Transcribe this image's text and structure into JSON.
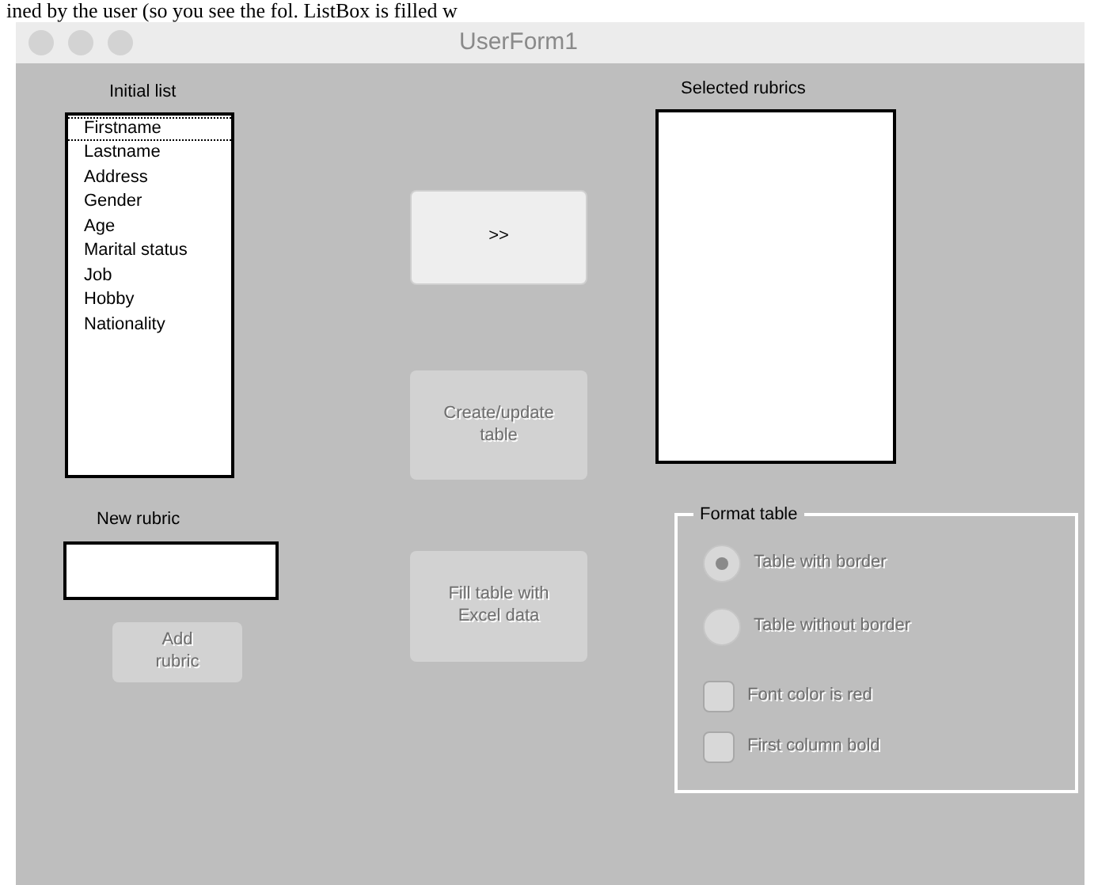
{
  "caption": "ined by the user (so you see the fol. ListBox is filled w",
  "window": {
    "title": "UserForm1"
  },
  "initial_list": {
    "label": "Initial list",
    "items": [
      {
        "text": "Firstname",
        "focused": true
      },
      {
        "text": "Lastname",
        "focused": false
      },
      {
        "text": "Address",
        "focused": false
      },
      {
        "text": "Gender",
        "focused": false
      },
      {
        "text": "Age",
        "focused": false
      },
      {
        "text": "Marital status",
        "focused": false
      },
      {
        "text": "Job",
        "focused": false
      },
      {
        "text": "Hobby",
        "focused": false
      },
      {
        "text": "Nationality",
        "focused": false
      }
    ]
  },
  "new_rubric": {
    "label": "New rubric"
  },
  "add_button": {
    "label": "Add rubric",
    "disabled": true
  },
  "buttons": [
    {
      "label": ">>",
      "disabled": false
    },
    {
      "label": "Create/update table",
      "disabled": true
    },
    {
      "label": "Fill table with Excel data",
      "disabled": true
    }
  ],
  "selected_rubrics": {
    "label": "Selected rubrics"
  },
  "format_table": {
    "title": "Format table",
    "options": [
      {
        "kind": "radio",
        "label": "Table with border",
        "checked": true,
        "disabled": true
      },
      {
        "kind": "radio",
        "label": "Table without border",
        "checked": false,
        "disabled": true
      },
      {
        "kind": "checkbox",
        "label": "Font color is red",
        "checked": false,
        "disabled": true
      },
      {
        "kind": "checkbox",
        "label": "First column bold",
        "checked": false,
        "disabled": true
      }
    ]
  }
}
